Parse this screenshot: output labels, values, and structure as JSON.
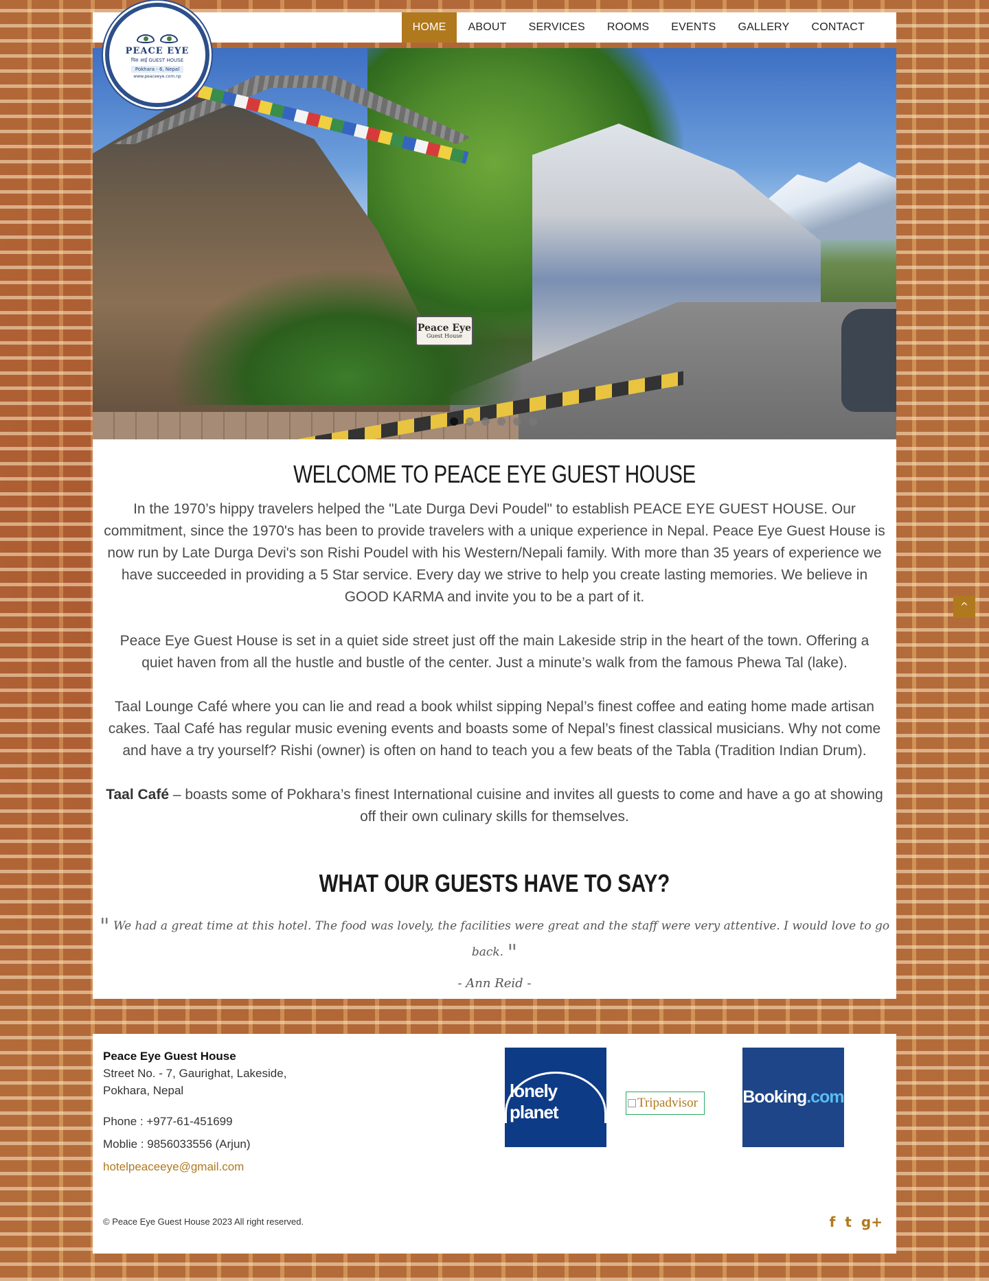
{
  "header": {
    "logo": {
      "name": "PEACE EYE",
      "sub": "पिस आई  GUEST HOUSE",
      "place": "Pokhara - 6, Nepal",
      "url": "www.peaceeye.com.np"
    },
    "nav": [
      {
        "label": "Home",
        "active": true
      },
      {
        "label": "About"
      },
      {
        "label": "Services"
      },
      {
        "label": "Rooms"
      },
      {
        "label": "Events"
      },
      {
        "label": "Gallery"
      },
      {
        "label": "Contact"
      }
    ]
  },
  "hero": {
    "sign_line1": "Peace Eye",
    "sign_line2": "Guest House",
    "slides_total": 6,
    "active_slide": 1
  },
  "main": {
    "welcome_title": "WELCOME TO PEACE EYE GUEST HOUSE",
    "para1": "In the 1970’s hippy travelers helped the \"Late Durga Devi Poudel\" to establish PEACE EYE GUEST HOUSE. Our commitment, since the 1970's has been to provide travelers with a unique experience in Nepal. Peace Eye Guest House is now run by Late Durga Devi's son Rishi Poudel with his Western/Nepali family. With more than 35 years of experience we have succeeded in providing a 5 Star service. Every day we strive to help you create lasting memories. We believe in GOOD KARMA and invite you to be a part of it.",
    "para2": "Peace Eye Guest House is set in a quiet side street just off the main Lakeside strip in the heart of the town. Offering a quiet haven from all the hustle and bustle of the center. Just a minute’s walk from the famous Phewa Tal (lake).",
    "para3": "Taal Lounge Café where you can lie and read a book whilst sipping Nepal’s finest coffee and eating home made artisan cakes. Taal Café has regular music evening events and boasts some of Nepal’s finest classical musicians. Why not come and have a try yourself? Rishi (owner) is often on hand to teach you a few beats of the Tabla (Tradition Indian Drum).",
    "para4_bold": "Taal Café",
    "para4": " – boasts some of Pokhara’s finest International cuisine and invites all guests to come and have a go at showing off their own culinary skills for themselves.",
    "guests_title": "WHAT OUR GUESTS HAVE TO SAY?",
    "quote_open": "\"",
    "quote": "We had a great time at this hotel. The food was lovely, the facilities were great and the staff were very attentive. I would love to go back.",
    "quote_close": "\"",
    "quote_author": "- Ann Reid -"
  },
  "scroll_top": {
    "icon": "chevron-up-icon",
    "glyph": "^"
  },
  "footer": {
    "name": "Peace Eye Guest House",
    "street": "Street No. - 7, Gaurighat, Lakeside,",
    "city": "Pokhara, Nepal",
    "phone": "Phone : +977-61-451699",
    "mobile": "Moblie : 9856033556 (Arjun)",
    "email": "hotelpeaceeye@gmail.com",
    "partners": {
      "lonely_planet": "lonely planet",
      "tripadvisor": "Tripadvisor",
      "booking_main": "Booking",
      "booking_dotcom": ".com"
    },
    "copyright": "© Peace Eye Guest House 2023 All right reserved.",
    "social": {
      "facebook": "f",
      "twitter": "t",
      "google": "g+"
    }
  },
  "colors": {
    "accent": "#b0791e",
    "logo_blue": "#2d4f8a",
    "lonely_planet_bg": "#0e3b86",
    "booking_bg": "#1d4587"
  }
}
